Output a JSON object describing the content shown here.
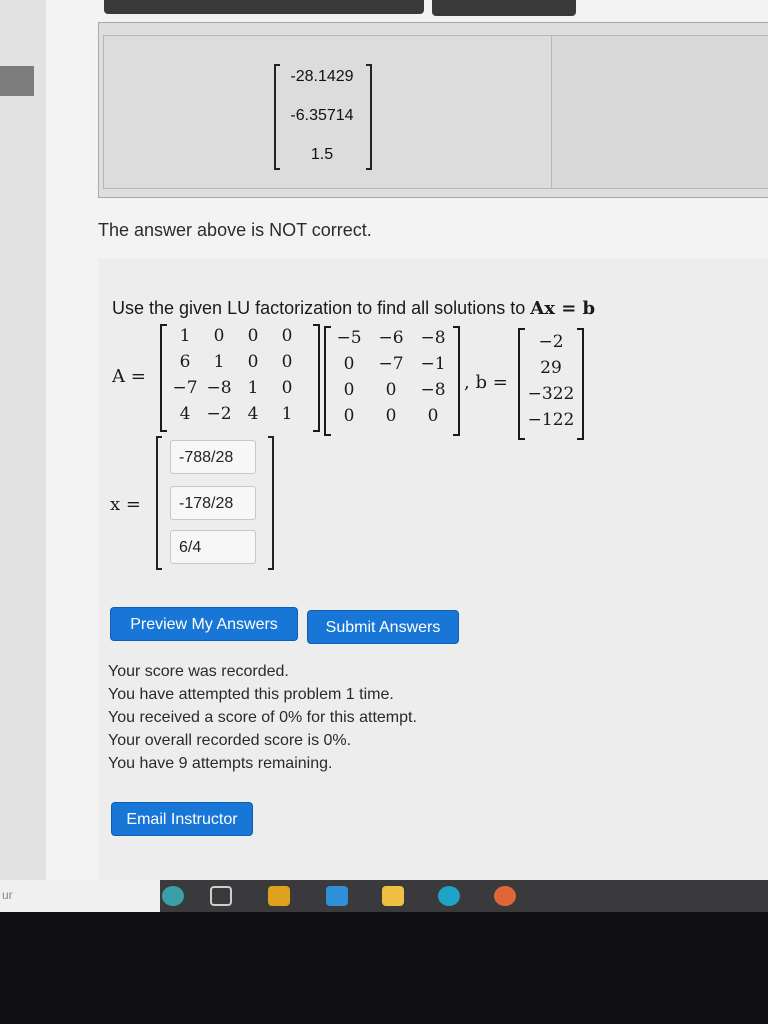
{
  "previous_answer": {
    "values": [
      "-28.1429",
      "-6.35714",
      "1.5"
    ],
    "message": "The answer above is NOT correct."
  },
  "problem": {
    "statement_prefix": "Use the given LU factorization to find all solutions to ",
    "statement_math": "Ax = b",
    "A_label": "A =",
    "b_label": ", b =",
    "x_label": "x =",
    "L": [
      [
        "1",
        "0",
        "0",
        "0"
      ],
      [
        "6",
        "1",
        "0",
        "0"
      ],
      [
        "−7",
        "−8",
        "1",
        "0"
      ],
      [
        "4",
        "−2",
        "4",
        "1"
      ]
    ],
    "U": [
      [
        "−5",
        "−6",
        "−8"
      ],
      [
        "0",
        "−7",
        "−1"
      ],
      [
        "0",
        "0",
        "−8"
      ],
      [
        "0",
        "0",
        "0"
      ]
    ],
    "b": [
      "−2",
      "29",
      "−322",
      "−122"
    ]
  },
  "answers": {
    "x1": "-788/28",
    "x2": "-178/28",
    "x3": "6/4"
  },
  "buttons": {
    "preview": "Preview My Answers",
    "submit": "Submit Answers",
    "email": "Email Instructor"
  },
  "result": {
    "line1": "Your score was recorded.",
    "line2": "You have attempted this problem 1 time.",
    "line3": "You received a score of 0% for this attempt.",
    "line4": "Your overall recorded score is 0%.",
    "line5": "You have 9 attempts remaining."
  },
  "taskbar": {
    "hint": "ur",
    "icons": [
      "weather-icon",
      "task-view-icon",
      "store-icon",
      "mail-icon",
      "file-explorer-icon",
      "edge-icon",
      "app-icon"
    ]
  },
  "colors": {
    "button_blue": "#1877d6",
    "taskbar": "#3a3a3c"
  }
}
